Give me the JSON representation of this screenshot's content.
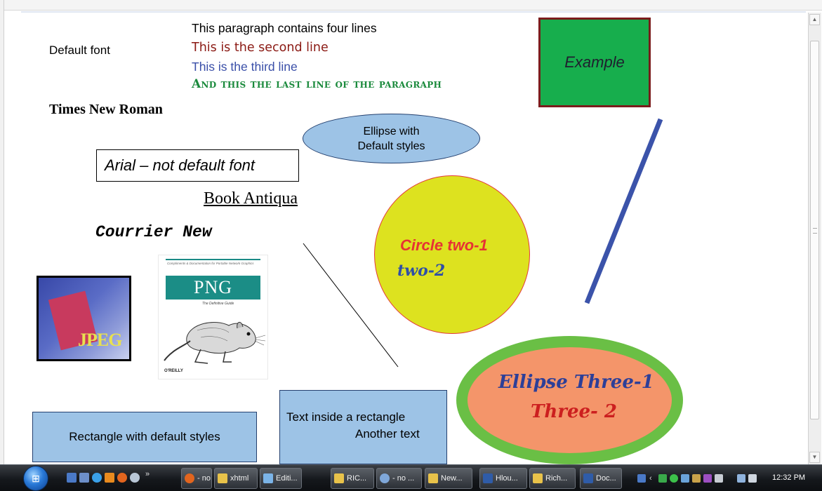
{
  "document": {
    "default_font_label": "Default font",
    "paragraph_lines": [
      "This paragraph contains four lines",
      "This is the second line",
      "This is the third line",
      "And this the last line of the paragraph"
    ],
    "example_label": "Example",
    "times_label": "Times New Roman",
    "ellipse_default": {
      "line1": "Ellipse with",
      "line2": "Default styles"
    },
    "arial_label": "Arial – not default font",
    "book_antiqua_label": "Book Antiqua",
    "courier_label": "Courrier New",
    "circle": {
      "line1": "Circle two-1",
      "line2": "two-2"
    },
    "jpeg_image": {
      "label": "JPEG"
    },
    "png_image": {
      "tagline": "Compliments & Documentation for Portable Network Graphics",
      "title": "PNG",
      "subtitle": "The Definitive Guide",
      "publisher": "O'REILLY"
    },
    "ellipse_three": {
      "line1": "Ellipse Three-1",
      "line2": "Three- 2"
    },
    "rect_default_label": "Rectangle with default styles",
    "rect_text": {
      "line1": "Text inside a rectangle",
      "line2": "Another text"
    }
  },
  "colors": {
    "paragraph_line2": "#8b1a14",
    "paragraph_line3": "#3a4fa8",
    "paragraph_line4": "#1a8a3c",
    "example_fill": "#17ae4d",
    "example_border": "#7b1c1c",
    "ellipse_fill": "#9dc3e6",
    "circle_fill": "#dde21f",
    "ellipse_three_fill": "#f4956a",
    "ellipse_three_border": "#6abf45",
    "blue_line": "#3b53aa"
  },
  "taskbar": {
    "start_icon": "windows-start-orb",
    "quick_launch": [
      "show-desktop-icon",
      "switch-windows-icon",
      "ie-icon",
      "media-icon",
      "firefox-icon",
      "orb-icon"
    ],
    "overflow_chevron": "»",
    "tasks": [
      {
        "label": "- no ...",
        "icon": "firefox-icon"
      },
      {
        "label": "xhtml",
        "icon": "folder-icon"
      },
      {
        "label": "Editi...",
        "icon": "app-icon"
      },
      {
        "label": "RIC...",
        "icon": "folder-icon"
      },
      {
        "label": "- no ...",
        "icon": "browser-icon"
      },
      {
        "label": "New...",
        "icon": "folder-icon"
      },
      {
        "label": "Hlou...",
        "icon": "word-icon"
      },
      {
        "label": "Rich...",
        "icon": "folder-icon"
      },
      {
        "label": "Doc...",
        "icon": "word-icon"
      }
    ],
    "clock": "12:32 PM",
    "tray_icons": [
      "desktop-icon",
      "chevron-left-icon",
      "network-icon",
      "shield-icon",
      "monitor-icon",
      "drive-icon",
      "app-icon",
      "keyboard-icon",
      "display-icon",
      "volume-icon"
    ]
  },
  "scrollbar": {
    "up_arrow": "▲",
    "down_arrow": "▼"
  }
}
